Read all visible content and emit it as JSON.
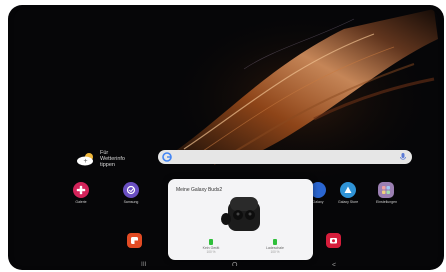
{
  "weather": {
    "line1": "Für",
    "line2": "Wetterinfo",
    "line3": "tippen"
  },
  "search": {
    "logo_letter": "G"
  },
  "apps": [
    {
      "label": "Galerie",
      "color": "#d3235a"
    },
    {
      "label": "Samsung",
      "color": "#6a4fc2"
    },
    {
      "label": "Galaxy",
      "color": "#2b66d1"
    },
    {
      "label": "Galaxy Store",
      "color": "#2f93d6"
    },
    {
      "label": "Einstellungen",
      "color": "#9b7fb2"
    }
  ],
  "popup": {
    "title": "Meine Galaxy Buds2",
    "left_bud": {
      "label": "Kein Gerät",
      "value": "100 %"
    },
    "case": {
      "label": "Ladeschale",
      "value": "100 %"
    }
  },
  "dock": [
    {
      "name": "notes",
      "color": "#e24b24"
    },
    {
      "name": "camera",
      "color": "#d61d3b"
    }
  ],
  "nav": {
    "recents": "|||",
    "home": "O",
    "back": "<"
  }
}
